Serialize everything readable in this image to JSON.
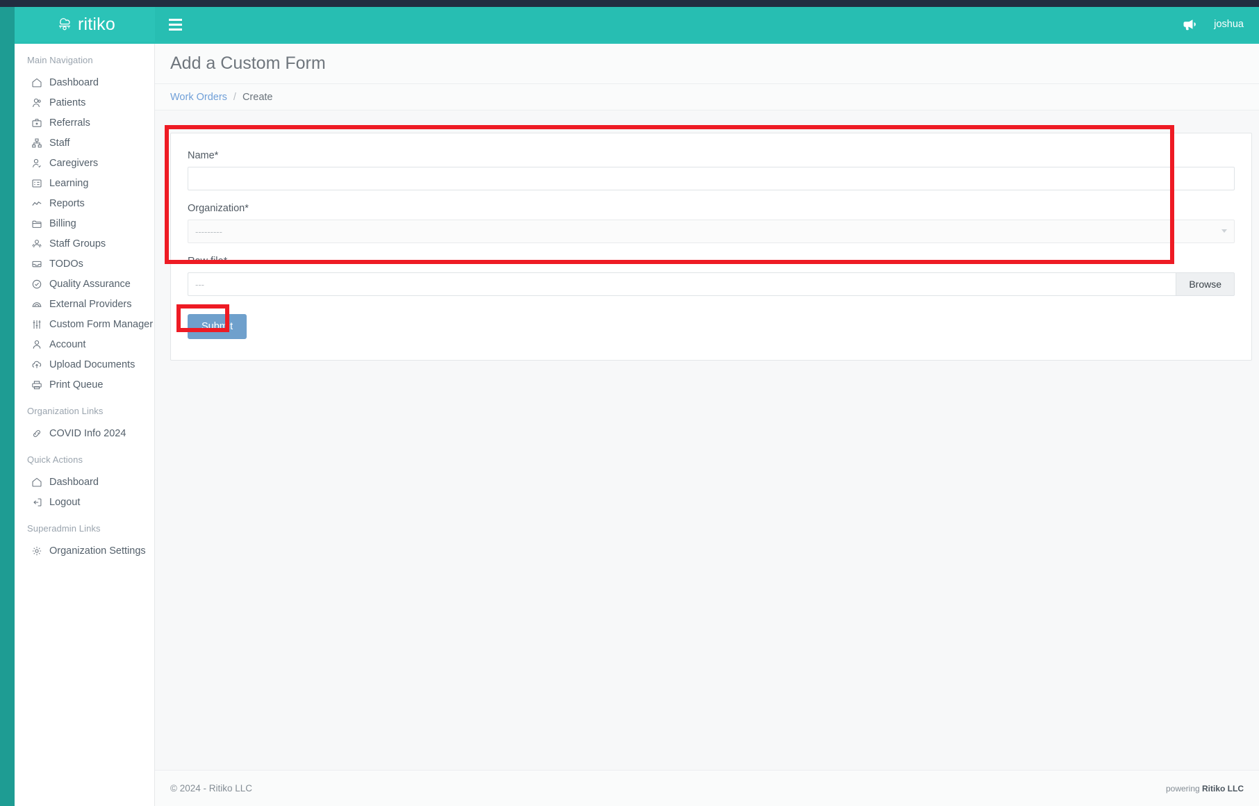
{
  "header": {
    "brand_name": "ritiko",
    "brand_icon": "cloud-network-logo-icon",
    "menu_icon": "hamburger-menu-icon",
    "announcement_icon": "bullhorn-icon",
    "username": "joshua",
    "accent_color": "#27beb2",
    "rail_color": "#222d40"
  },
  "sidebar": {
    "sections": [
      {
        "title": "Main Navigation",
        "items": [
          {
            "label": "Dashboard",
            "icon": "home-icon"
          },
          {
            "label": "Patients",
            "icon": "patient-icon"
          },
          {
            "label": "Referrals",
            "icon": "briefcase-icon"
          },
          {
            "label": "Staff",
            "icon": "org-chart-icon"
          },
          {
            "label": "Caregivers",
            "icon": "user-check-icon"
          },
          {
            "label": "Learning",
            "icon": "id-card-icon"
          },
          {
            "label": "Reports",
            "icon": "line-chart-icon"
          },
          {
            "label": "Billing",
            "icon": "folder-icon"
          },
          {
            "label": "Staff Groups",
            "icon": "users-group-icon"
          },
          {
            "label": "TODOs",
            "icon": "inbox-icon"
          },
          {
            "label": "Quality Assurance",
            "icon": "check-circle-icon"
          },
          {
            "label": "External Providers",
            "icon": "arch-icon"
          },
          {
            "label": "Custom Form Manager",
            "icon": "sliders-icon"
          },
          {
            "label": "Account",
            "icon": "user-icon"
          },
          {
            "label": "Upload Documents",
            "icon": "cloud-upload-icon"
          },
          {
            "label": "Print Queue",
            "icon": "printer-icon"
          }
        ]
      },
      {
        "title": "Organization Links",
        "items": [
          {
            "label": "COVID Info 2024",
            "icon": "link-icon"
          }
        ]
      },
      {
        "title": "Quick Actions",
        "items": [
          {
            "label": "Dashboard",
            "icon": "home-icon"
          },
          {
            "label": "Logout",
            "icon": "logout-icon"
          }
        ]
      },
      {
        "title": "Superadmin Links",
        "items": [
          {
            "label": "Organization Settings",
            "icon": "gear-icon"
          }
        ]
      }
    ]
  },
  "page": {
    "title": "Add a Custom Form",
    "breadcrumb": {
      "link": "Work Orders",
      "separator": "/",
      "current": "Create"
    }
  },
  "form": {
    "name": {
      "label": "Name*",
      "value": "",
      "placeholder": ""
    },
    "organization": {
      "label": "Organization*",
      "selected": "---------",
      "caret_icon": "chevron-down-icon"
    },
    "raw_file": {
      "label": "Raw file*",
      "value": "---",
      "browse_label": "Browse"
    },
    "submit_label": "Submit",
    "submit_color": "#6fa0cc"
  },
  "annotations": {
    "color": "#ee1b24",
    "boxes": [
      {
        "name": "form-fields-highlight"
      },
      {
        "name": "submit-button-highlight"
      }
    ]
  },
  "footer": {
    "copyright": "© 2024 - Ritiko LLC",
    "powering_prefix": "powering ",
    "powering_brand": "Ritiko LLC"
  }
}
